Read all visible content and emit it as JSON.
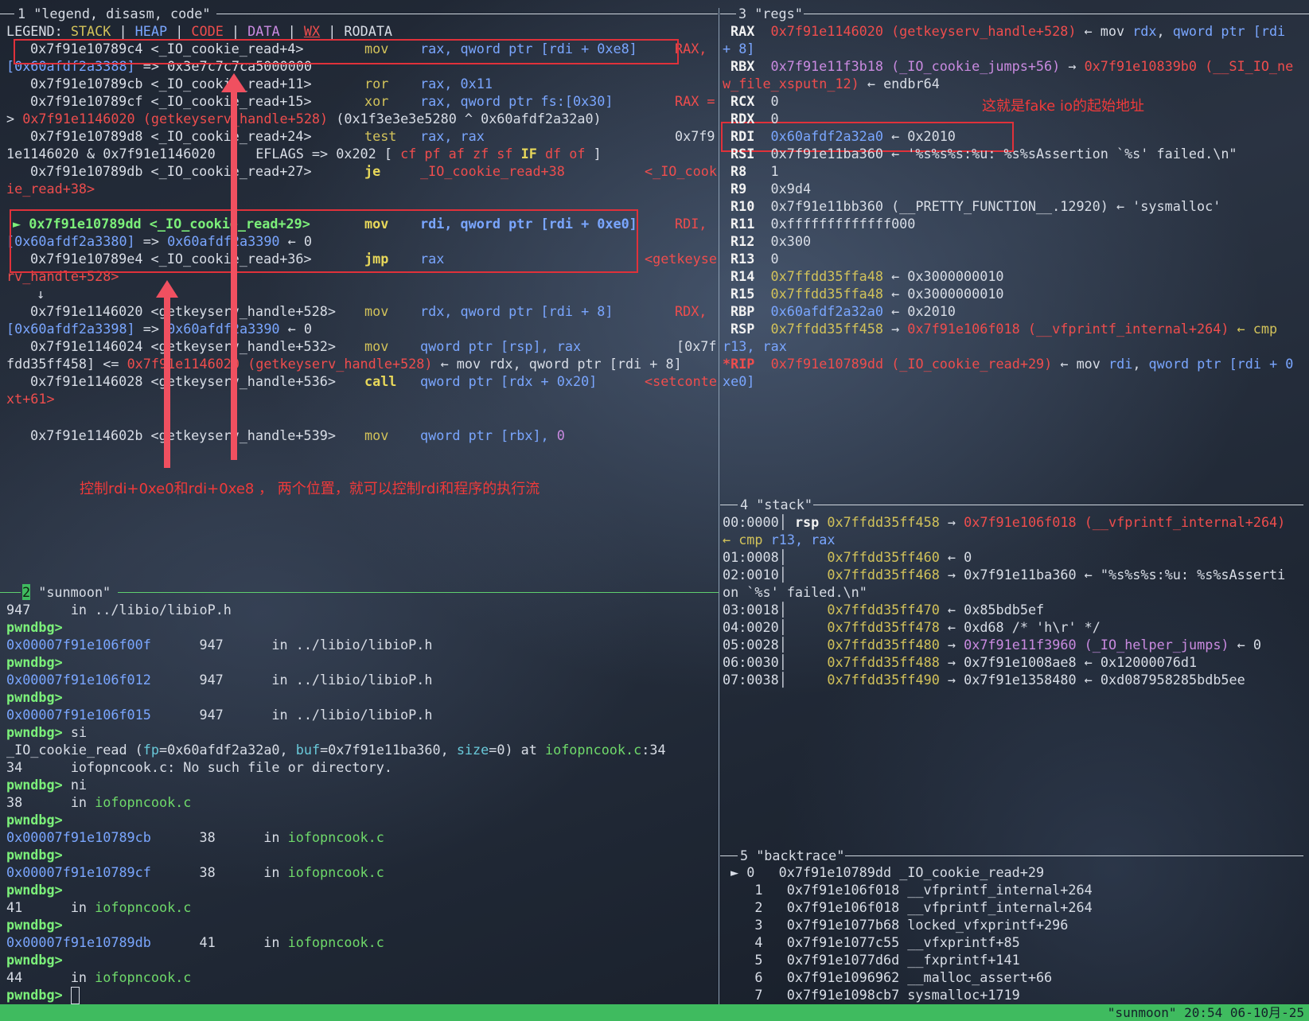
{
  "panes": {
    "p1": "1 \"legend, disasm, code\"",
    "p2": "2",
    "p2_name": "\"sunmoon\"",
    "p3": "3 \"regs\"",
    "p4": "4 \"stack\"",
    "p5": "5 \"backtrace\""
  },
  "legend": {
    "label": "LEGEND: ",
    "stack": "STACK",
    "heap": "HEAP",
    "code": "CODE",
    "data": "DATA",
    "wx": "WX",
    "rodata": "RODATA",
    "sep": " | "
  },
  "disasm": {
    "l1_addr": "0x7f91e10789c4",
    "l1_sym": " <_IO_cookie_read+4>",
    "l1_op": "mov",
    "l1_args": "rax, qword ptr [rdi + 0xe8]",
    "l1_tail": "RAX,",
    "l2a": "[0x60afdf2a3388]",
    "l2b": " => 0x3e7c7c7ca5000000",
    "l3_addr": "0x7f91e10789cb",
    "l3_sym": " <_IO_cookie_read+11>",
    "l3_op": "ror",
    "l3_args": "rax, 0x11",
    "l4_addr": "0x7f91e10789cf",
    "l4_sym": " <_IO_cookie_read+15>",
    "l4_op": "xor",
    "l4_args": "rax, qword ptr fs:[0x30]",
    "l4_tail": "RAX =",
    "l5a": "> ",
    "l5b": "0x7f91e1146020 (getkeyserv_handle+528)",
    "l5c": " (0x1f3e3e3e5280 ^ 0x60afdf2a32a0)",
    "l6_addr": "0x7f91e10789d8",
    "l6_sym": " <_IO_cookie_read+24>",
    "l6_op": "test",
    "l6_args": "rax, rax",
    "l6_tail": "0x7f9",
    "l7a": "1e1146020 & 0x7f91e1146020",
    "l7b": "     EFLAGS => 0x202 [ ",
    "l7c": "cf pf af zf sf ",
    "l7d": "IF",
    "l7e": " df of",
    "l7f": " ]",
    "l8_addr": "0x7f91e10789db",
    "l8_sym": " <_IO_cookie_read+27>",
    "l8_op": "je",
    "l8_args": "_IO_cookie_read+38",
    "l8_tail": "<_IO_cook",
    "l9": "ie_read+38>",
    "l10_mark": "► ",
    "l10_addr": "0x7f91e10789dd",
    "l10_sym": " <_IO_cookie_read+29>",
    "l10_op": "mov",
    "l10_args": "rdi, qword ptr [rdi + 0xe0]",
    "l10_tail": "RDI,",
    "l11a": "[0x60afdf2a3380]",
    "l11b": " => ",
    "l11c": "0x60afdf2a3390",
    "l11d": " ← 0",
    "l12_addr": "0x7f91e10789e4",
    "l12_sym": " <_IO_cookie_read+36>",
    "l12_op": "jmp",
    "l12_args": "rax",
    "l12_tail": "<getkeyse",
    "l13": "rv_handle+528>",
    "l14": "↓",
    "l15_addr": "0x7f91e1146020",
    "l15_sym": " <getkeyserv_handle+528>",
    "l15_op": "mov",
    "l15_args": "rdx, qword ptr [rdi + 8]",
    "l15_tail": "RDX,",
    "l16a": "[0x60afdf2a3398]",
    "l16b": " => ",
    "l16c": "0x60afdf2a3390",
    "l16d": " ← 0",
    "l17_addr": "0x7f91e1146024",
    "l17_sym": " <getkeyserv_handle+532>",
    "l17_op": "mov",
    "l17_args": "qword ptr [rsp], rax",
    "l17_tail": "[0x7f",
    "l18a": "fdd35ff458] <= ",
    "l18b": "0x7f91e1146020 (getkeyserv_handle+528)",
    "l18c": " ← mov rdx, qword ptr [rdi + 8]",
    "l19_addr": "0x7f91e1146028",
    "l19_sym": " <getkeyserv_handle+536>",
    "l19_op": "call",
    "l19_args": "qword ptr [rdx + 0x20]",
    "l19_tail": "<setconte",
    "l20": "xt+61>",
    "l21_addr": "0x7f91e114602b",
    "l21_sym": " <getkeyserv_handle+539>",
    "l21_op": "mov",
    "l21_args": "qword ptr [rbx], ",
    "l21_zero": "0"
  },
  "annotations": {
    "control": "控制rdi+0xe0和rdi+0xe8 ， 两个位置，就可以控制rdi和程序的执行流",
    "fake_io": "这就是fake io的起始地址"
  },
  "regs": {
    "rax_name": "RAX",
    "rax_v": "0x7f91e1146020 (getkeyserv_handle+528)",
    "rax_t1": " ← mov ",
    "rax_t2": "rdx",
    "rax_t3": ", ",
    "rax_t4": "qword ptr [rdi",
    "rax_cont": "+ 8]",
    "rbx_name": "RBX",
    "rbx_v": "0x7f91e11f3b18 (_IO_cookie_jumps+56)",
    "rbx_t": " → ",
    "rbx_v2": "0x7f91e10839b0 (__SI_IO_ne",
    "rbx_cont": "w_file_xsputn_12)",
    "rbx_cont2": " ← endbr64",
    "rcx_name": "RCX",
    "rcx_v": "0",
    "rdx_name": "RDX",
    "rdx_v": "0",
    "rdi_name": "RDI",
    "rdi_v": "0x60afdf2a32a0",
    "rdi_t": " ← 0x2010",
    "rsi_name": "RSI",
    "rsi_v": "0x7f91e11ba360",
    "rsi_t": " ← '%s%s%s:%u: %s%sAssertion `%s' failed.\\n\"",
    "r8_name": "R8",
    "r8_v": "1",
    "r9_name": "R9",
    "r9_v": "0x9d4",
    "r10_name": "R10",
    "r10_v": "0x7f91e11bb360 (__PRETTY_FUNCTION__.12920)",
    "r10_t": " ← 'sysmalloc'",
    "r11_name": "R11",
    "r11_v": "0xfffffffffffff000",
    "r12_name": "R12",
    "r12_v": "0x300",
    "r13_name": "R13",
    "r13_v": "0",
    "r14_name": "R14",
    "r14_v": "0x7ffdd35ffa48",
    "r14_t": " ← 0x3000000010",
    "r15_name": "R15",
    "r15_v": "0x7ffdd35ffa48",
    "r15_t": " ← 0x3000000010",
    "rbp_name": "RBP",
    "rbp_v": "0x60afdf2a32a0",
    "rbp_t": " ← 0x2010",
    "rsp_name": "RSP",
    "rsp_v": "0x7ffdd35ff458",
    "rsp_t": " → ",
    "rsp_v2": "0x7f91e106f018 (__vfprintf_internal+264)",
    "rsp_t2": " ← cmp",
    "rsp_cont1": "r13",
    "rsp_cont2": ", rax",
    "rip_name": "*RIP",
    "rip_v": "0x7f91e10789dd (_IO_cookie_read+29)",
    "rip_t1": " ← mov ",
    "rip_t2": "rdi",
    "rip_t3": ", ",
    "rip_t4": "qword ptr [rdi + 0",
    "rip_cont": "xe0]"
  },
  "stack": [
    {
      "off": "00:0000",
      "reg": "rsp",
      "addr": "0x7ffdd35ff458",
      "arrow": " → ",
      "val": "0x7f91e106f018 (__vfprintf_internal+264)",
      "val_class": "r",
      "cont_a": "← cmp ",
      "cont_b": "r13",
      "cont_c": ", rax"
    },
    {
      "off": "01:0008",
      "reg": "",
      "addr": "0x7ffdd35ff460",
      "arrow": " ← ",
      "val": "0",
      "val_class": "w"
    },
    {
      "off": "02:0010",
      "reg": "",
      "addr": "0x7ffdd35ff468",
      "arrow": " → ",
      "val": "0x7f91e11ba360 ← \"%s%s%s:%u: %s%sAsserti",
      "val_class": "w",
      "cont": "on `%s' failed.\\n\""
    },
    {
      "off": "03:0018",
      "reg": "",
      "addr": "0x7ffdd35ff470",
      "arrow": " ← ",
      "val": "0x85bdb5ef",
      "val_class": "w"
    },
    {
      "off": "04:0020",
      "reg": "",
      "addr": "0x7ffdd35ff478",
      "arrow": " ← ",
      "val": "0xd68 /* 'h\\r' */",
      "val_class": "w"
    },
    {
      "off": "05:0028",
      "reg": "",
      "addr": "0x7ffdd35ff480",
      "arrow": " → ",
      "val": "0x7f91e11f3960 (_IO_helper_jumps)",
      "val_class": "m",
      "tail": " ← 0"
    },
    {
      "off": "06:0030",
      "reg": "",
      "addr": "0x7ffdd35ff488",
      "arrow": " → ",
      "val": "0x7f91e1008ae8 ← 0x12000076d1",
      "val_class": "w"
    },
    {
      "off": "07:0038",
      "reg": "",
      "addr": "0x7ffdd35ff490",
      "arrow": " → ",
      "val": "0x7f91e1358480 ← 0xd087958285bdb5ee",
      "val_class": "w"
    }
  ],
  "backtrace": [
    {
      "mark": "►",
      "n": "0",
      "addr": "0x7f91e10789dd",
      "sym": "_IO_cookie_read+29"
    },
    {
      "mark": "",
      "n": "1",
      "addr": "0x7f91e106f018",
      "sym": "__vfprintf_internal+264"
    },
    {
      "mark": "",
      "n": "2",
      "addr": "0x7f91e106f018",
      "sym": "__vfprintf_internal+264"
    },
    {
      "mark": "",
      "n": "3",
      "addr": "0x7f91e1077b68",
      "sym": "locked_vfxprintf+296"
    },
    {
      "mark": "",
      "n": "4",
      "addr": "0x7f91e1077c55",
      "sym": "__vfxprintf+85"
    },
    {
      "mark": "",
      "n": "5",
      "addr": "0x7f91e1077d6d",
      "sym": "__fxprintf+141"
    },
    {
      "mark": "",
      "n": "6",
      "addr": "0x7f91e1096962",
      "sym": "__malloc_assert+66"
    },
    {
      "mark": "",
      "n": "7",
      "addr": "0x7f91e1098cb7",
      "sym": "sysmalloc+1719"
    }
  ],
  "console": {
    "c1a": "947",
    "c1b": "     in ",
    "c1c": "../libio/libioP.h",
    "prompt": "pwndbg>",
    "c3a": "0x00007f91e106f00f",
    "c3b": "      947      in ",
    "c3c": "../libio/libioP.h",
    "c5a": "0x00007f91e106f012",
    "c5b": "      947      in ",
    "c5c": "../libio/libioP.h",
    "c7a": "0x00007f91e106f015",
    "c7b": "      947      in ",
    "c7c": "../libio/libioP.h",
    "c8cmd": " si",
    "c9a": "_IO_cookie_read (",
    "c9b": "fp",
    "c9c": "=0x60afdf2a32a0, ",
    "c9d": "buf",
    "c9e": "=0x7f91e11ba360, ",
    "c9f": "size",
    "c9g": "=0) at ",
    "c9h": "iofopncook.c",
    "c9i": ":34",
    "c10": "34      iofopncook.c: No such file or directory.",
    "c11cmd": " ni",
    "c12a": "38      in ",
    "c12b": "iofopncook.c",
    "c14a": "0x00007f91e10789cb",
    "c14b": "      38      in ",
    "c14c": "iofopncook.c",
    "c16a": "0x00007f91e10789cf",
    "c16b": "      38      in ",
    "c16c": "iofopncook.c",
    "c18a": "41      in ",
    "c18b": "iofopncook.c",
    "c20a": "0x00007f91e10789db",
    "c20b": "      41      in ",
    "c20c": "iofopncook.c",
    "c22a": "44      in ",
    "c22b": "iofopncook.c"
  },
  "status_bar": "\"sunmoon\" 20:54 06-10月-25"
}
